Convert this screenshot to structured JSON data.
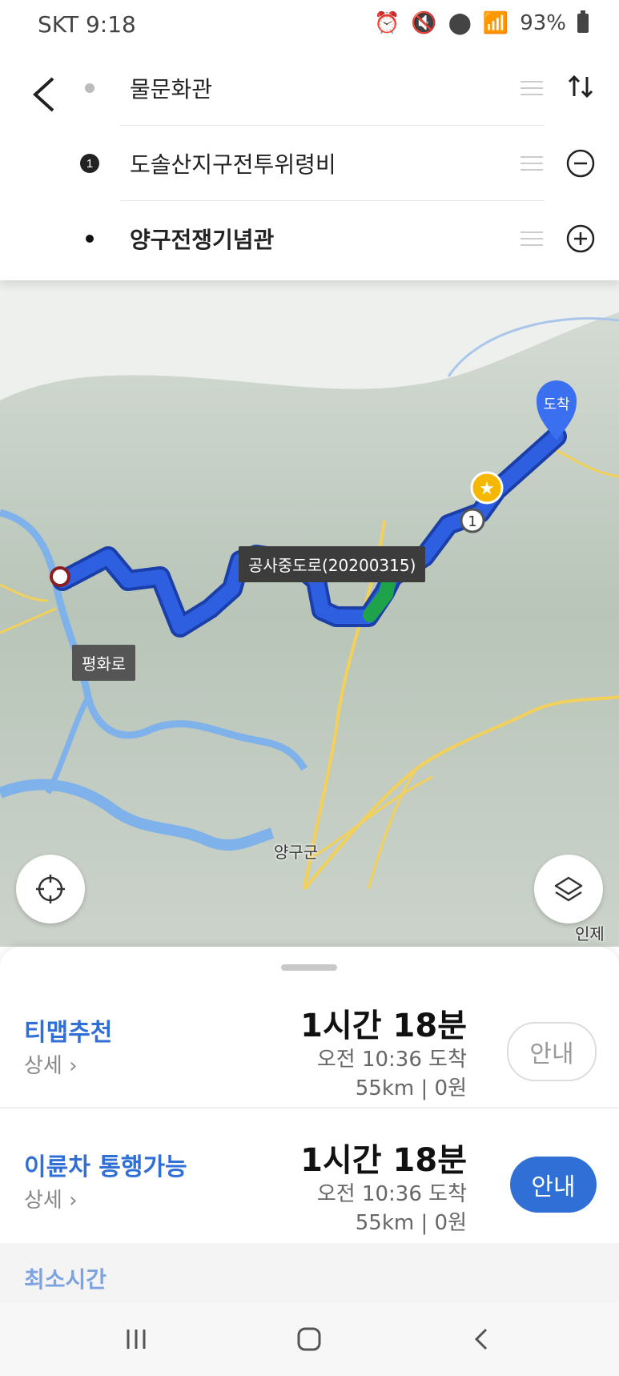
{
  "status_bar": {
    "carrier_time": "SKT 9:18",
    "battery": "93%"
  },
  "route": {
    "origin": "물문화관",
    "waypoint_badge": "1",
    "waypoint": "도솔산지구전투위령비",
    "destination": "양구전쟁기념관"
  },
  "map": {
    "arrival_pin": "도착",
    "construction_tag": "공사중도로(20200315)",
    "road_tag": "평화로",
    "town_label": "양구군",
    "edge_label": "인제군",
    "waypoint_marker": "1"
  },
  "options": [
    {
      "name": "티맵추천",
      "detail": "상세",
      "duration": "1시간 18분",
      "eta": "오전 10:36 도착",
      "distance": "55km",
      "toll": "0원",
      "go_label": "안내",
      "selected": false
    },
    {
      "name": "이륜차 통행가능",
      "detail": "상세",
      "duration": "1시간 18분",
      "eta": "오전 10:36 도착",
      "distance": "55km",
      "toll": "0원",
      "go_label": "안내",
      "selected": true
    }
  ],
  "peek_text": "최소시간",
  "colors": {
    "accent": "#2f6fd6",
    "route": "#2d5fe0",
    "construction": "#1fa34a",
    "star_marker": "#f5b700"
  }
}
